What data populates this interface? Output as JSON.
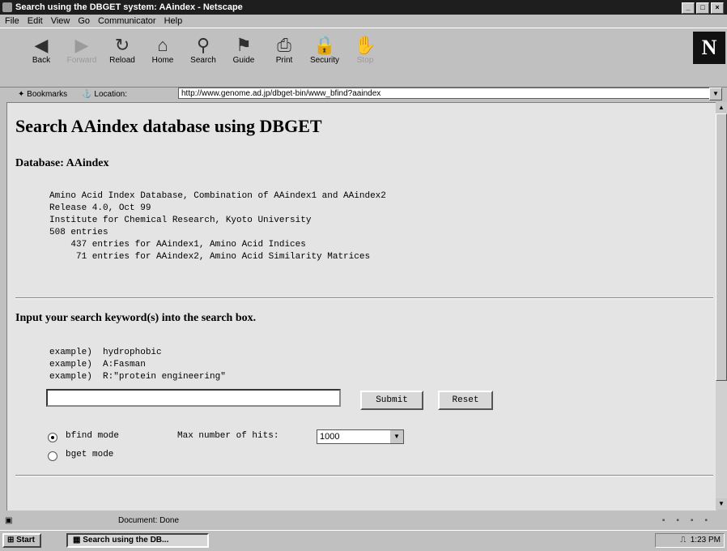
{
  "window": {
    "title": "Search using the DBGET system: AAindex - Netscape"
  },
  "menu": [
    "File",
    "Edit",
    "View",
    "Go",
    "Communicator",
    "Help"
  ],
  "toolbar": [
    {
      "label": "Back",
      "icon": "back-arrow-icon",
      "disabled": false
    },
    {
      "label": "Forward",
      "icon": "forward-arrow-icon",
      "disabled": true
    },
    {
      "label": "Reload",
      "icon": "reload-icon",
      "disabled": false
    },
    {
      "label": "Home",
      "icon": "home-icon",
      "disabled": false
    },
    {
      "label": "Search",
      "icon": "search-icon",
      "disabled": false
    },
    {
      "label": "Guide",
      "icon": "guide-icon",
      "disabled": false
    },
    {
      "label": "Print",
      "icon": "print-icon",
      "disabled": false
    },
    {
      "label": "Security",
      "icon": "security-icon",
      "disabled": false
    },
    {
      "label": "Stop",
      "icon": "stop-icon",
      "disabled": true
    }
  ],
  "location": {
    "bookmarks_label": "Bookmarks",
    "location_label": "Location:",
    "url": "http://www.genome.ad.jp/dbget-bin/www_bfind?aaindex"
  },
  "page": {
    "title": "Search AAindex database using DBGET",
    "db_heading": "Database: AAindex",
    "db_info": [
      "Amino Acid Index Database, Combination of AAindex1 and AAindex2",
      "Release 4.0, Oct 99",
      "Institute for Chemical Research, Kyoto University",
      "508 entries",
      "    437 entries for AAindex1, Amino Acid Indices",
      "     71 entries for AAindex2, Amino Acid Similarity Matrices"
    ],
    "instruction": "Input your search keyword(s) into the search box.",
    "examples": [
      "example)  hydrophobic",
      "example)  A:Fasman",
      "example)  R:\"protein engineering\""
    ],
    "search_value": "",
    "submit_label": "Submit",
    "reset_label": "Reset",
    "mode_bfind": "bfind mode",
    "max_hits_label": "Max number of hits:",
    "max_hits_value": "1000",
    "mode_bget": "bget mode"
  },
  "status": {
    "text": "Document: Done"
  },
  "taskbar": {
    "start": "Start",
    "task": "Search using the DB...",
    "clock": "1:23 PM"
  }
}
